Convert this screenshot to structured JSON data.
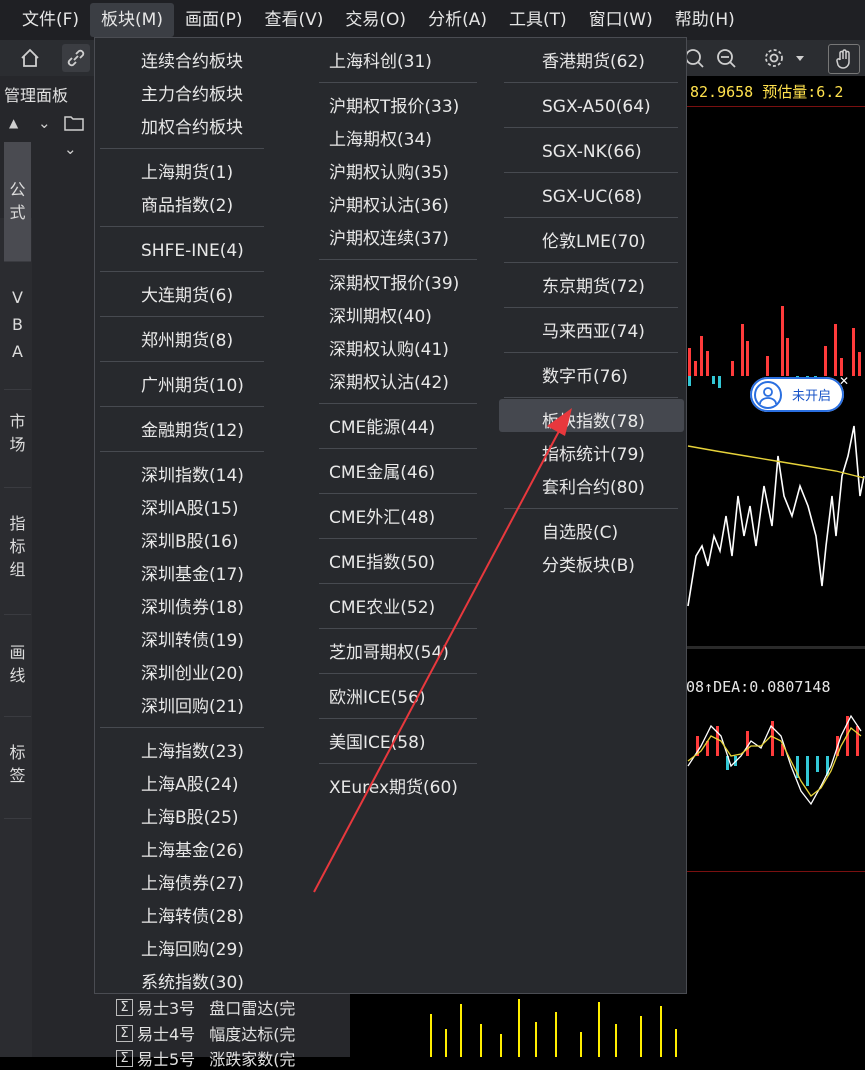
{
  "menubar": {
    "items": [
      "文件(F)",
      "板块(M)",
      "画面(P)",
      "查看(V)",
      "交易(O)",
      "分析(A)",
      "工具(T)",
      "窗口(W)",
      "帮助(H)"
    ]
  },
  "panel": {
    "title": "管理面板",
    "tabs": [
      "公式",
      "VBA",
      "市场",
      "指标组",
      "画线",
      "标签"
    ],
    "tree_rows": [
      {
        "name": "易士3号",
        "desc": "盘口雷达(完"
      },
      {
        "name": "易士4号",
        "desc": "幅度达标(完"
      },
      {
        "name": "易士5号",
        "desc": "涨跌家数(完"
      }
    ]
  },
  "chart": {
    "top_info": "82.9658 预估量:6.2",
    "macd_info": "08↑DEA:0.0807148",
    "tip_label": "未开启"
  },
  "menu": {
    "col1": [
      [
        "连续合约板块",
        "主力合约板块",
        "加权合约板块"
      ],
      [
        "上海期货(1)",
        "商品指数(2)"
      ],
      [
        "SHFE-INE(4)"
      ],
      [
        "大连期货(6)"
      ],
      [
        "郑州期货(8)"
      ],
      [
        "广州期货(10)"
      ],
      [
        "金融期货(12)"
      ],
      [
        "深圳指数(14)",
        "深圳A股(15)",
        "深圳B股(16)",
        "深圳基金(17)",
        "深圳债券(18)",
        "深圳转债(19)",
        "深圳创业(20)",
        "深圳回购(21)"
      ],
      [
        "上海指数(23)",
        "上海A股(24)",
        "上海B股(25)",
        "上海基金(26)",
        "上海债券(27)",
        "上海转债(28)",
        "上海回购(29)",
        "系统指数(30)"
      ]
    ],
    "col2": [
      [
        "上海科创(31)"
      ],
      [
        "沪期权T报价(33)",
        "上海期权(34)",
        "沪期权认购(35)",
        "沪期权认沽(36)",
        "沪期权连续(37)"
      ],
      [
        "深期权T报价(39)",
        "深圳期权(40)",
        "深期权认购(41)",
        "深期权认沽(42)"
      ],
      [
        "CME能源(44)"
      ],
      [
        "CME金属(46)"
      ],
      [
        "CME外汇(48)"
      ],
      [
        "CME指数(50)"
      ],
      [
        "CME农业(52)"
      ],
      [
        "芝加哥期权(54)"
      ],
      [
        "欧洲ICE(56)"
      ],
      [
        "美国ICE(58)"
      ],
      [
        "XEurex期货(60)"
      ]
    ],
    "col3": [
      [
        "香港期货(62)"
      ],
      [
        "SGX-A50(64)"
      ],
      [
        "SGX-NK(66)"
      ],
      [
        "SGX-UC(68)"
      ],
      [
        "伦敦LME(70)"
      ],
      [
        "东京期货(72)"
      ],
      [
        "马来西亚(74)"
      ],
      [
        "数字币(76)"
      ],
      [
        "板块指数(78)",
        "指标统计(79)",
        "套利合约(80)"
      ],
      [
        "自选股(C)",
        "分类板块(B)"
      ]
    ],
    "highlighted": "板块指数(78)"
  },
  "colors": {
    "menu_bg": "#27292d",
    "highlight": "#45484f",
    "annotation_arrow": "#e8383d",
    "bar_up": "#ff3b3b",
    "bar_down": "#33c8d6",
    "volume": "#ffee00"
  }
}
